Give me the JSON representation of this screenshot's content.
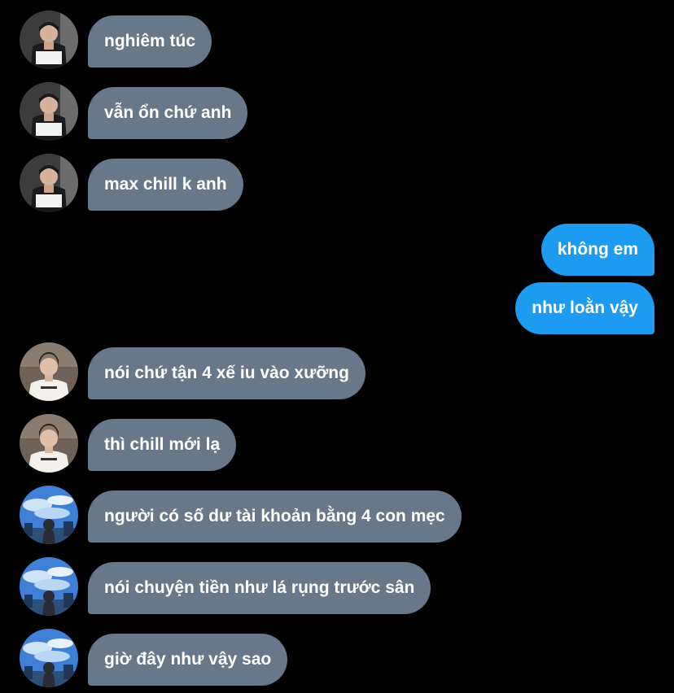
{
  "messages": [
    {
      "side": "in",
      "avatar": "user-photo-dark-jacket",
      "text": "nghiêm túc"
    },
    {
      "side": "in",
      "avatar": "user-photo-dark-jacket",
      "text": "vẫn ổn chứ anh"
    },
    {
      "side": "in",
      "avatar": "user-photo-dark-jacket",
      "text": "max chill k anh"
    },
    {
      "side": "out",
      "text": "không em"
    },
    {
      "side": "out",
      "text": "như loằn vậy"
    },
    {
      "side": "in",
      "avatar": "user-photo-white-tee",
      "text": "nói chứ tận 4 xế iu vào xưỡng"
    },
    {
      "side": "in",
      "avatar": "user-photo-white-tee",
      "text": "thì chill mới lạ"
    },
    {
      "side": "in",
      "avatar": "user-photo-blue-sky",
      "text": "người có số dư tài khoản bằng 4 con mẹc"
    },
    {
      "side": "in",
      "avatar": "user-photo-blue-sky",
      "text": "nói chuyện tiền như lá rụng trước sân"
    },
    {
      "side": "in",
      "avatar": "user-photo-blue-sky",
      "text": "giờ đây như vậy sao"
    }
  ],
  "colors": {
    "background": "#000000",
    "incoming_bubble": "#66788a",
    "outgoing_bubble": "#1d9bf0",
    "text": "#ffffff"
  }
}
